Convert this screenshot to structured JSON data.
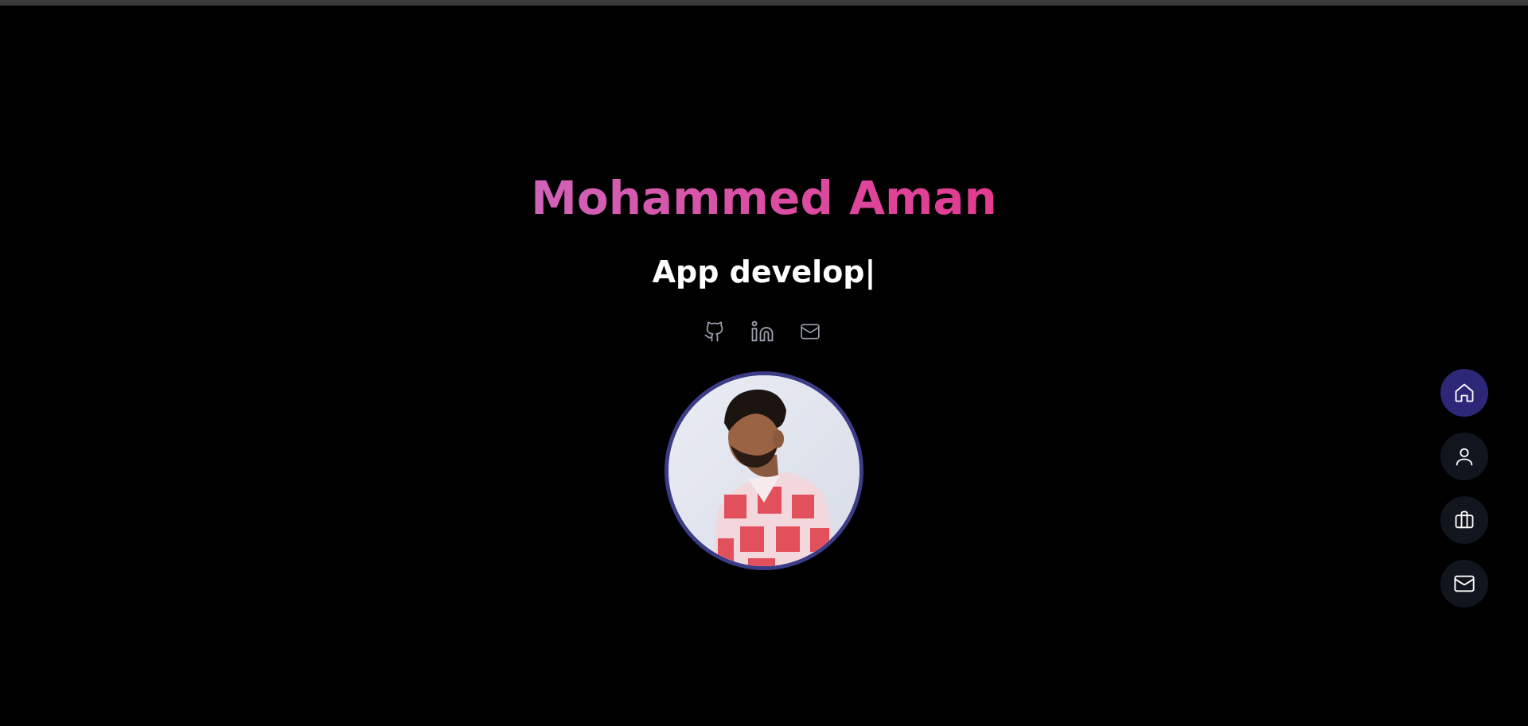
{
  "hero": {
    "name": "Mohammed Aman",
    "role_typed": "App develop|"
  },
  "social": [
    {
      "icon": "github-icon"
    },
    {
      "icon": "linkedin-icon"
    },
    {
      "icon": "mail-icon"
    }
  ],
  "sidenav": [
    {
      "icon": "home-icon",
      "active": true
    },
    {
      "icon": "user-icon",
      "active": false
    },
    {
      "icon": "briefcase-icon",
      "active": false
    },
    {
      "icon": "mail-icon",
      "active": false
    }
  ],
  "colors": {
    "background": "#000000",
    "name_gradient_start": "#d063b8",
    "name_gradient_end": "#e23a8e",
    "avatar_ring": "#3b3c86",
    "nav_active": "#2c2777",
    "nav_inactive": "#11151e"
  }
}
